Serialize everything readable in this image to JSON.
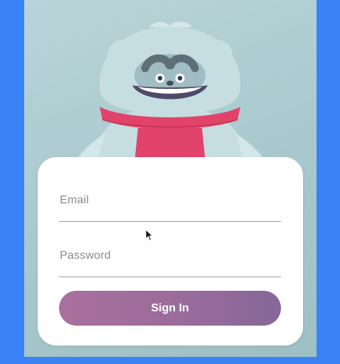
{
  "login": {
    "email_label": "Email",
    "password_label": "Password",
    "signin_label": "Sign In"
  },
  "mascot": {
    "icon": "yeti-mascot",
    "scarf_color": "#e2436b",
    "fur_color": "#c6dde1"
  },
  "colors": {
    "page_background": "#3b82f6",
    "button_gradient_start": "#a9709d",
    "button_gradient_end": "#85679a"
  }
}
